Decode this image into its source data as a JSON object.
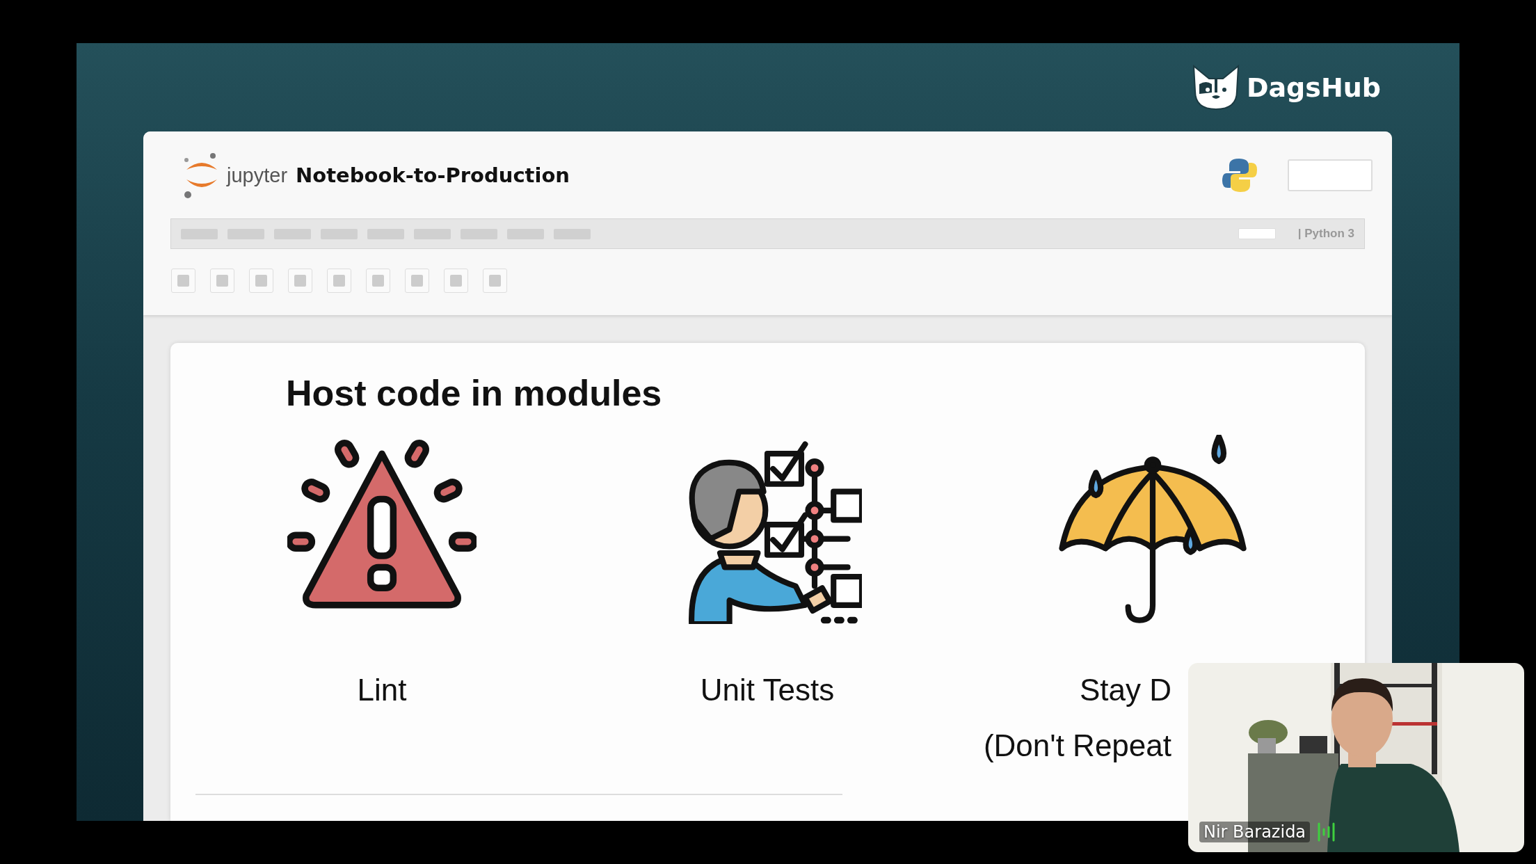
{
  "logo": {
    "text": "DagsHub"
  },
  "notebook": {
    "brand": "jupyter",
    "title": "Notebook-to-Production",
    "kernel": "| Python 3"
  },
  "slide": {
    "heading": "Host code in modules",
    "items": [
      {
        "kind": "warning",
        "label": "Lint"
      },
      {
        "kind": "checklist",
        "label": "Unit Tests"
      },
      {
        "kind": "umbrella",
        "label": "Stay D",
        "sublabel": "(Don't Repeat"
      }
    ]
  },
  "video": {
    "name": "Nir Barazida"
  }
}
